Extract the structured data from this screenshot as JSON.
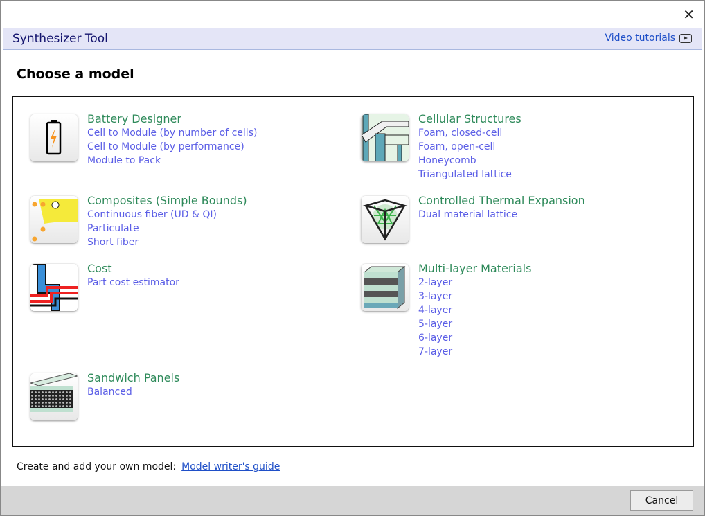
{
  "window": {
    "close_label": "✕"
  },
  "header": {
    "title": "Synthesizer Tool",
    "video_tutorials": "Video tutorials"
  },
  "page_title": "Choose a model",
  "models": [
    {
      "title": "Battery Designer",
      "links": [
        "Cell to Module (by number of cells)",
        "Cell to Module (by performance)",
        "Module to Pack"
      ]
    },
    {
      "title": "Cellular Structures",
      "links": [
        "Foam, closed-cell",
        "Foam, open-cell",
        "Honeycomb",
        "Triangulated lattice"
      ]
    },
    {
      "title": "Composites (Simple Bounds)",
      "links": [
        "Continuous fiber (UD & QI)",
        "Particulate",
        "Short fiber"
      ]
    },
    {
      "title": "Controlled Thermal Expansion",
      "links": [
        "Dual material lattice"
      ]
    },
    {
      "title": "Cost",
      "links": [
        "Part cost estimator"
      ]
    },
    {
      "title": "Multi-layer Materials",
      "links": [
        "2-layer",
        "3-layer",
        "4-layer",
        "5-layer",
        "6-layer",
        "7-layer"
      ]
    },
    {
      "title": "Sandwich Panels",
      "links": [
        "Balanced"
      ]
    }
  ],
  "footer": {
    "note": "Create and add your own model:",
    "guide_link": "Model writer's guide",
    "cancel": "Cancel"
  },
  "colors": {
    "title_green": "#2e8a5a",
    "link_blue": "#5b5ee6",
    "header_bg": "#e4e5f7"
  }
}
